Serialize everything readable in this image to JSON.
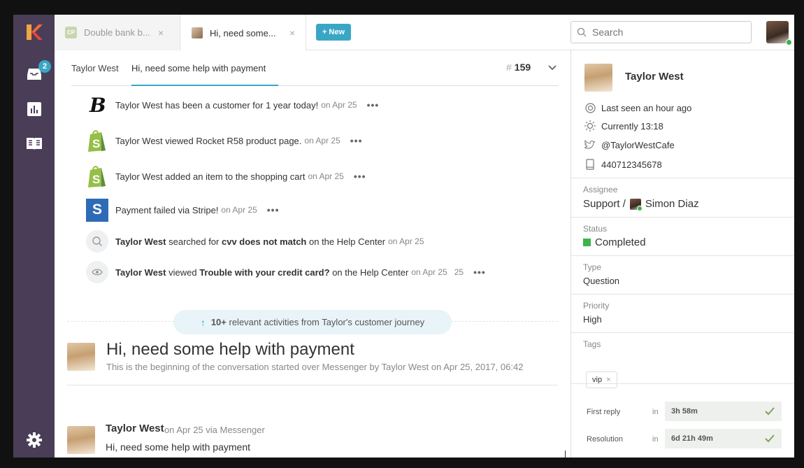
{
  "sidebar": {
    "inbox_badge": "2",
    "items": [
      {
        "name": "inbox",
        "icon": "inbox-icon"
      },
      {
        "name": "reports",
        "icon": "bar-chart-icon"
      },
      {
        "name": "knowledge-base",
        "icon": "book-icon"
      },
      {
        "name": "settings",
        "icon": "gear-icon"
      }
    ]
  },
  "tabs": [
    {
      "icon_text": "CP",
      "label": "Double bank b...",
      "close": "×",
      "active": false
    },
    {
      "label": "Hi, need some...",
      "close": "×",
      "active": true
    }
  ],
  "new_button": "+ New",
  "search": {
    "placeholder": "Search"
  },
  "breadcrumb": {
    "customer": "Taylor West",
    "conversation": "Hi, need some help with payment",
    "hash": "#",
    "ticket_number": "159"
  },
  "activities": [
    {
      "icon": "brand-b-icon",
      "text": "Taylor West has been a customer for 1 year today!",
      "date": "on Apr 25"
    },
    {
      "icon": "shopify-icon",
      "text": "Taylor West viewed Rocket R58 product page.",
      "date": "on Apr 25"
    },
    {
      "icon": "shopify-icon",
      "text": "Taylor West added an item to the shopping cart",
      "date": "on Apr 25"
    },
    {
      "icon": "stripe-icon",
      "text": "Payment failed via Stripe!",
      "date": "on Apr 25"
    },
    {
      "icon": "search-icon",
      "name": "Taylor West",
      "pre": "searched for",
      "term": "cvv does not match",
      "post": "on the Help Center",
      "date": "on Apr 25"
    },
    {
      "icon": "eye-icon",
      "name": "Taylor West",
      "pre": "viewed",
      "term": "Trouble with your credit card?",
      "post": "on the Help Center",
      "date": "on Apr 25",
      "trail": "25"
    }
  ],
  "journey": {
    "count": "10+",
    "text": "relevant activities from Taylor's customer journey"
  },
  "conversation": {
    "title": "Hi, need some help with payment",
    "subtitle": "This is the beginning of the conversation started over Messenger by Taylor West on Apr 25, 2017, 06:42"
  },
  "message": {
    "author": "Taylor West",
    "meta": "on Apr 25 via Messenger",
    "text": "Hi, need some help with payment"
  },
  "customer": {
    "name": "Taylor West",
    "last_seen": "Last seen an hour ago",
    "local_time": "Currently 13:18",
    "twitter": "@TaylorWestCafe",
    "phone": "440712345678"
  },
  "details": {
    "assignee_label": "Assignee",
    "assignee_team": "Support /",
    "assignee_agent": "Simon Diaz",
    "status_label": "Status",
    "status_value": "Completed",
    "status_color": "#3cb44b",
    "type_label": "Type",
    "type_value": "Question",
    "priority_label": "Priority",
    "priority_value": "High",
    "tags_label": "Tags",
    "tags": [
      "vip"
    ],
    "tag_remove": "×"
  },
  "sla": {
    "in_label": "in",
    "first_reply_label": "First reply",
    "first_reply_value": "3h 58m",
    "resolution_label": "Resolution",
    "resolution_value": "6d 21h 49m"
  },
  "colors": {
    "accent": "#3aa6c6",
    "sidebar": "#4a3d57",
    "online": "#3cb44b"
  }
}
